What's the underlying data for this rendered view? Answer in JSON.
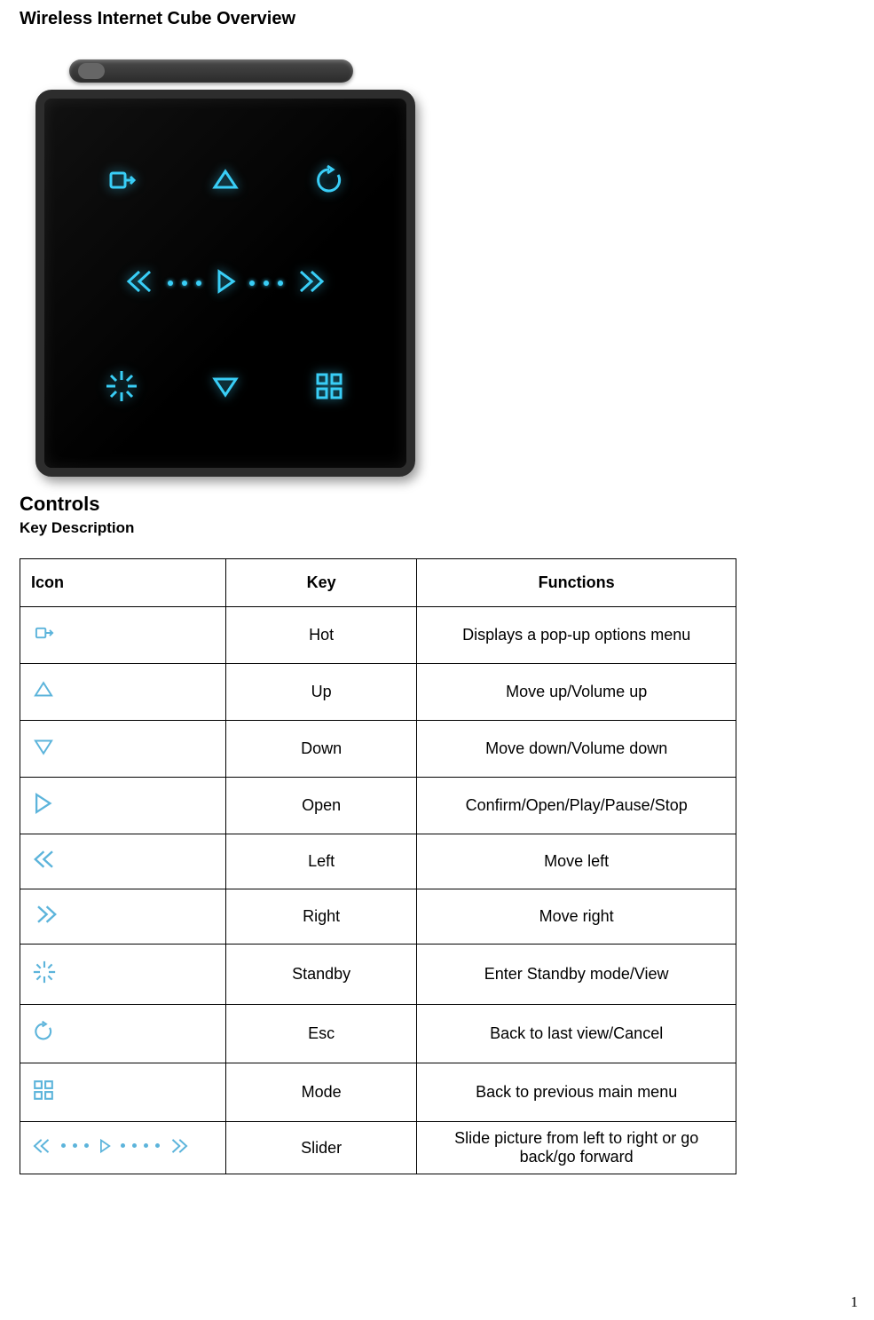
{
  "title": "Wireless Internet Cube Overview",
  "section_controls": "Controls",
  "section_keydesc": "Key Description",
  "table": {
    "headers": {
      "icon": "Icon",
      "key": "Key",
      "fn": "Functions"
    },
    "rows": [
      {
        "icon": "hot-icon",
        "key": "Hot",
        "fn": "Displays a pop-up options menu"
      },
      {
        "icon": "up-icon",
        "key": "Up",
        "fn": "Move up/Volume up"
      },
      {
        "icon": "down-icon",
        "key": "Down",
        "fn": "Move down/Volume down"
      },
      {
        "icon": "open-icon",
        "key": "Open",
        "fn": "Confirm/Open/Play/Pause/Stop"
      },
      {
        "icon": "left-icon",
        "key": "Left",
        "fn": "Move left"
      },
      {
        "icon": "right-icon",
        "key": "Right",
        "fn": "Move right"
      },
      {
        "icon": "standby-icon",
        "key": "Standby",
        "fn": "Enter Standby mode/View"
      },
      {
        "icon": "esc-icon",
        "key": "Esc",
        "fn": "Back to last view/Cancel"
      },
      {
        "icon": "mode-icon",
        "key": "Mode",
        "fn": "Back to previous main menu"
      },
      {
        "icon": "slider-icon",
        "key": "Slider",
        "fn": "Slide picture from left to right or go back/go forward"
      }
    ]
  },
  "page_number": "1"
}
